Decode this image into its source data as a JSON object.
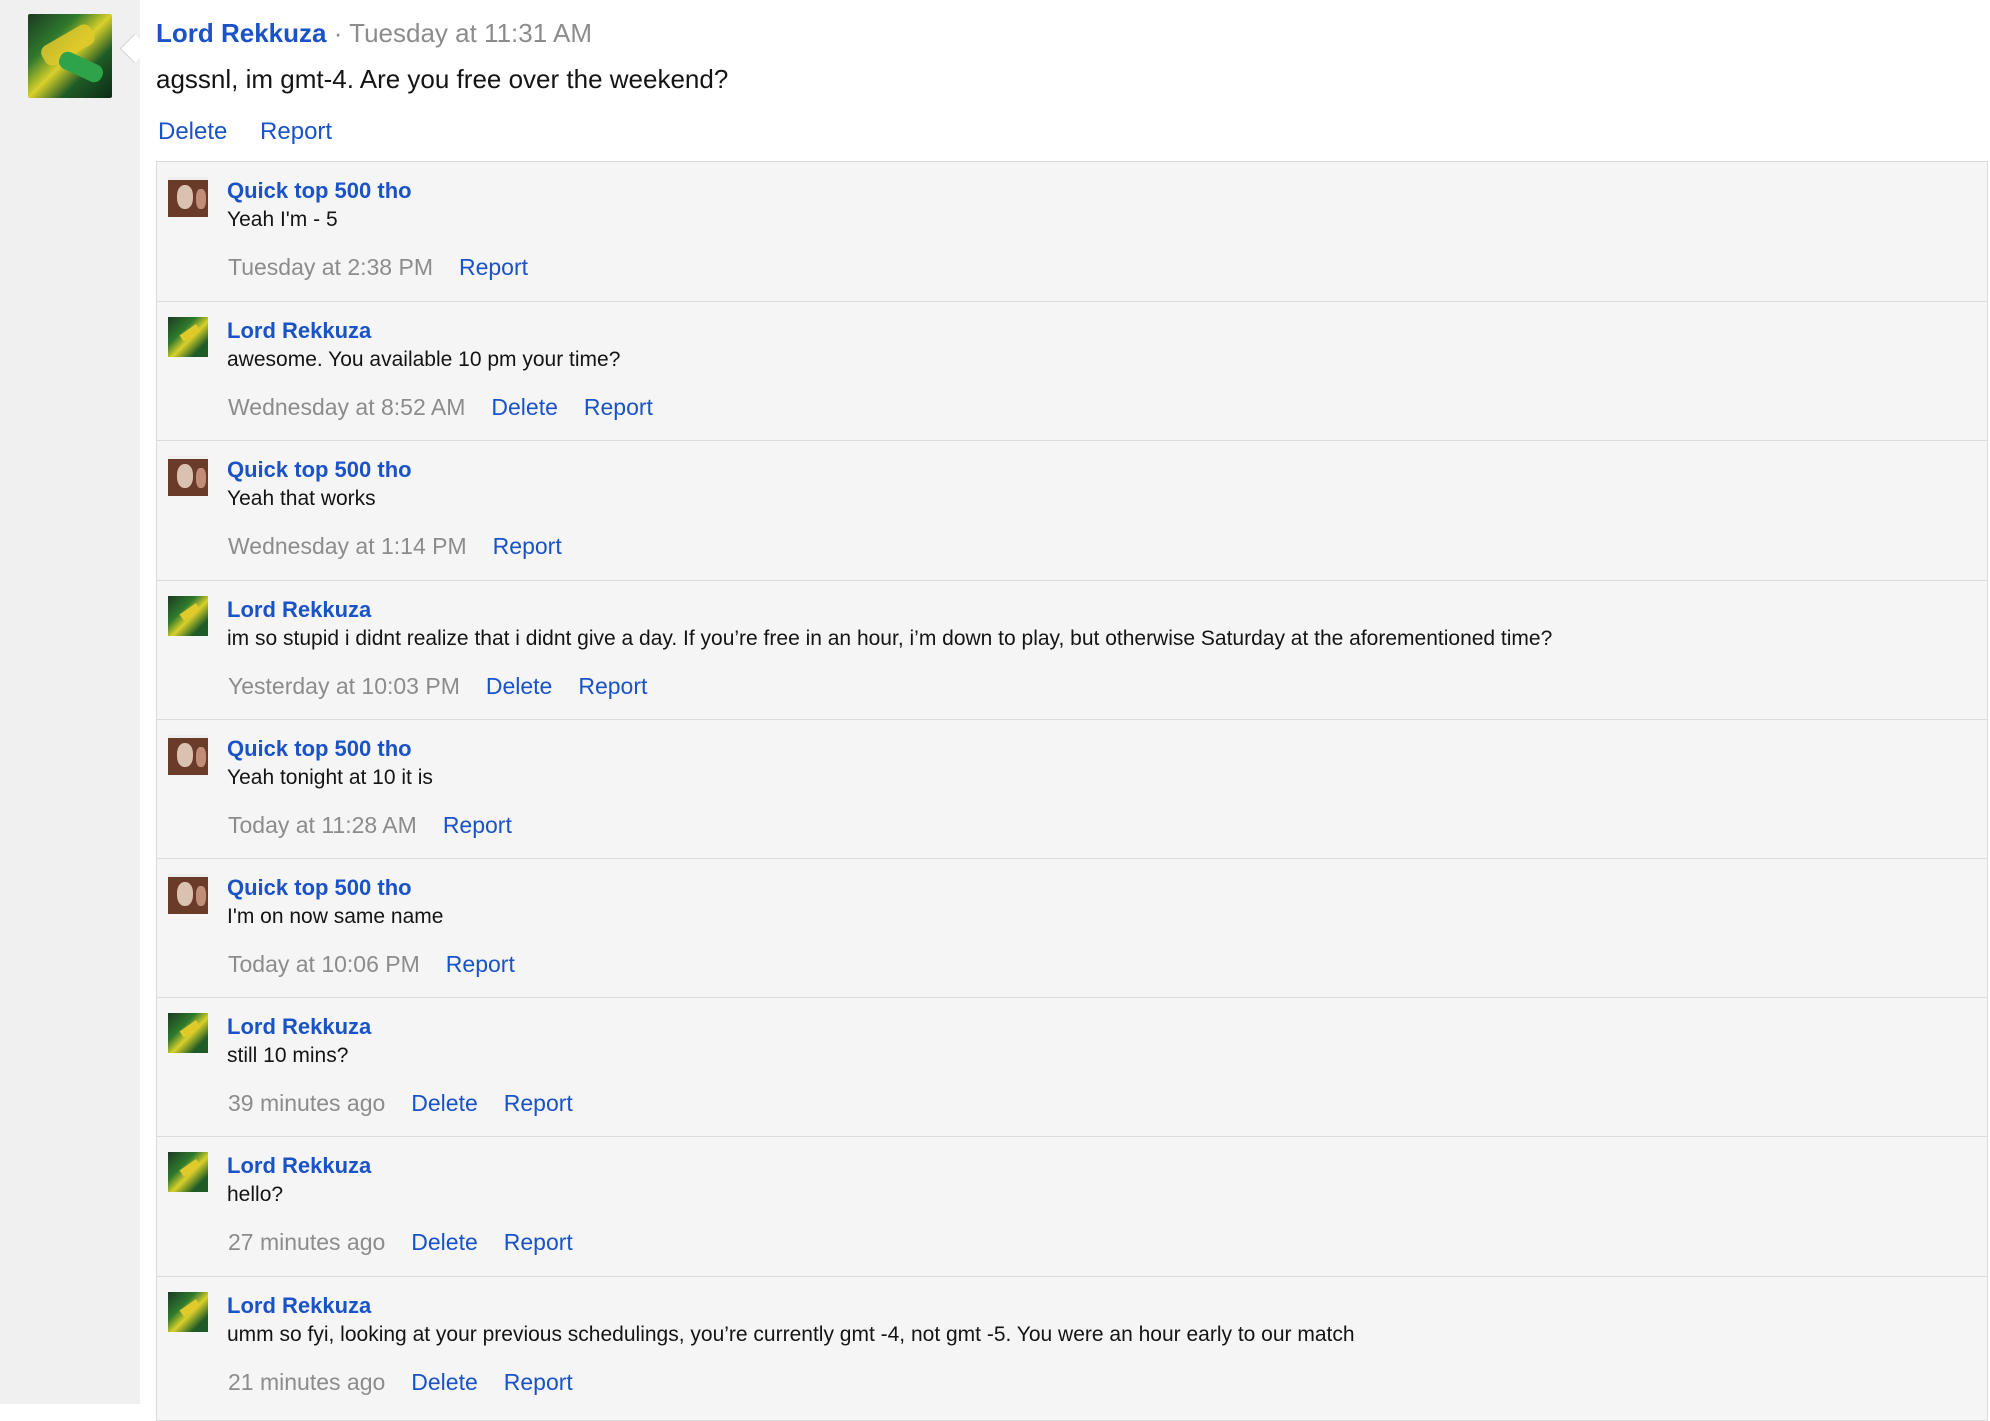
{
  "main_post": {
    "author": "Lord Rekkuza",
    "separator": "·",
    "time": "Tuesday at 11:31 AM",
    "text": "agssnl, im gmt-4. Are you free over the weekend?",
    "actions": [
      "Delete",
      "Report"
    ]
  },
  "comments": [
    {
      "author": "Quick top 500 tho",
      "avatar": "quick",
      "text": "Yeah I'm - 5",
      "time": "Tuesday at 2:38 PM",
      "actions": [
        "Report"
      ]
    },
    {
      "author": "Lord Rekkuza",
      "avatar": "rekkuza",
      "text": "awesome. You available 10 pm your time?",
      "time": "Wednesday at 8:52 AM",
      "actions": [
        "Delete",
        "Report"
      ]
    },
    {
      "author": "Quick top 500 tho",
      "avatar": "quick",
      "text": "Yeah that works",
      "time": "Wednesday at 1:14 PM",
      "actions": [
        "Report"
      ]
    },
    {
      "author": "Lord Rekkuza",
      "avatar": "rekkuza",
      "text": "im so stupid i didnt realize that i didnt give a day. If you’re free in an hour, i’m down to play, but otherwise Saturday at the aforementioned time?",
      "time": "Yesterday at 10:03 PM",
      "actions": [
        "Delete",
        "Report"
      ]
    },
    {
      "author": "Quick top 500 tho",
      "avatar": "quick",
      "text": "Yeah tonight at 10 it is",
      "time": "Today at 11:28 AM",
      "actions": [
        "Report"
      ]
    },
    {
      "author": "Quick top 500 tho",
      "avatar": "quick",
      "text": "I'm on now same name",
      "time": "Today at 10:06 PM",
      "actions": [
        "Report"
      ]
    },
    {
      "author": "Lord Rekkuza",
      "avatar": "rekkuza",
      "text": "still 10 mins?",
      "time": "39 minutes ago",
      "actions": [
        "Delete",
        "Report"
      ]
    },
    {
      "author": "Lord Rekkuza",
      "avatar": "rekkuza",
      "text": "hello?",
      "time": "27 minutes ago",
      "actions": [
        "Delete",
        "Report"
      ]
    },
    {
      "author": "Lord Rekkuza",
      "avatar": "rekkuza",
      "text": "umm so fyi, looking at your previous schedulings, you’re currently gmt -4, not gmt -5. You were an hour early to our match",
      "time": "21 minutes ago",
      "actions": [
        "Delete",
        "Report"
      ]
    }
  ],
  "colors": {
    "link": "#1a52c8",
    "muted": "#8c8c8c",
    "thread_bg": "#f5f5f5",
    "gutter_bg": "#f0f0f0"
  }
}
